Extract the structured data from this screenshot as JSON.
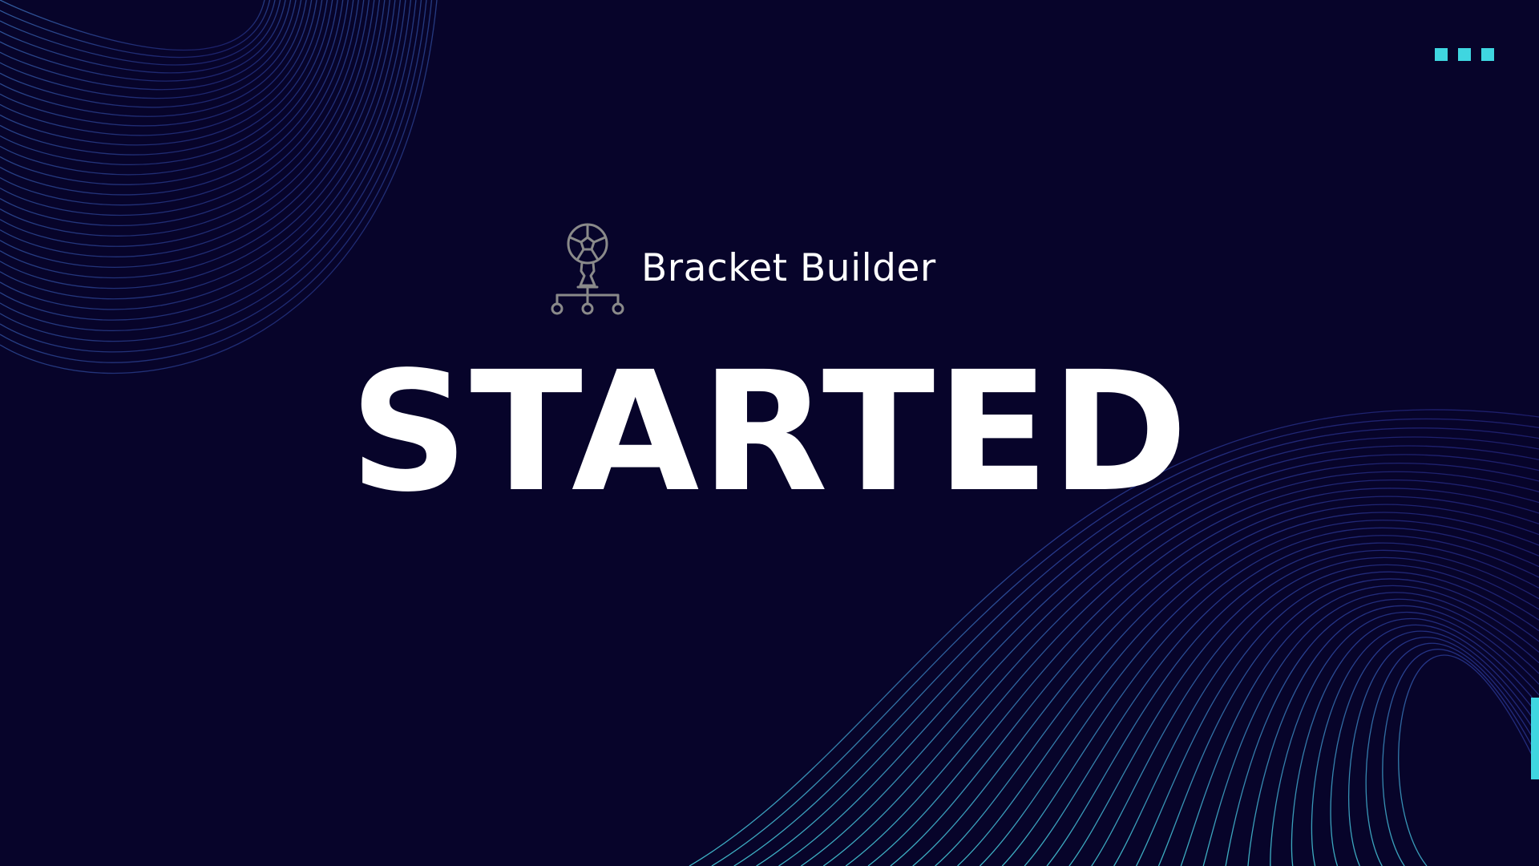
{
  "brand": {
    "name": "Bracket Builder",
    "logo_icon": "trophy-bracket-icon"
  },
  "headline": "STARTED",
  "menu": {
    "icon": "menu-dots-icon"
  },
  "colors": {
    "background": "#07042a",
    "accent": "#3fd6e0",
    "text": "#ffffff",
    "logo": "#8a8a8a"
  }
}
